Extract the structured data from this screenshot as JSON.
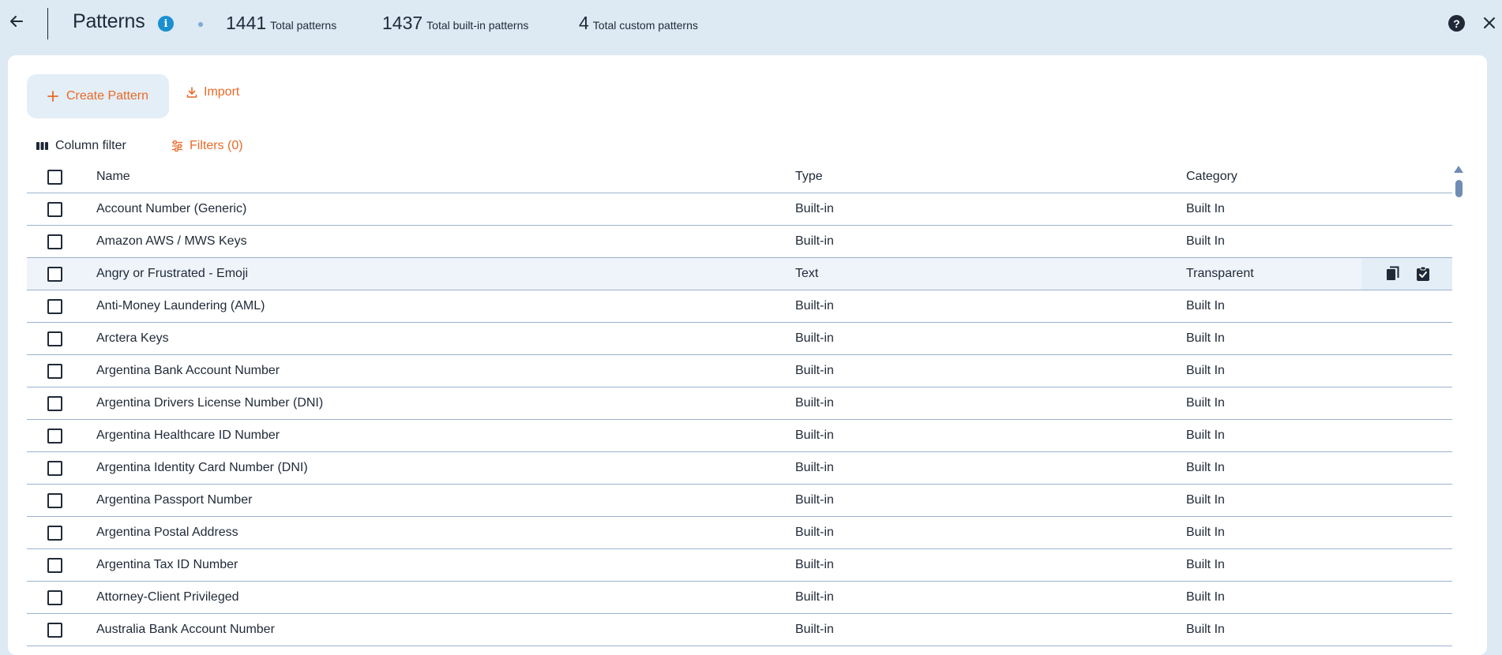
{
  "header": {
    "title": "Patterns",
    "stats": [
      {
        "value": "1441",
        "label": "Total patterns"
      },
      {
        "value": "1437",
        "label": "Total built-in patterns"
      },
      {
        "value": "4",
        "label": "Total custom patterns"
      }
    ]
  },
  "toolbar": {
    "create_label": "Create Pattern",
    "import_label": "Import",
    "column_filter_label": "Column filter",
    "filters_label": "Filters (0)"
  },
  "table": {
    "columns": [
      "Name",
      "Type",
      "Category"
    ],
    "rows": [
      {
        "name": "Account Number (Generic)",
        "type": "Built-in",
        "category": "Built In"
      },
      {
        "name": "Amazon AWS / MWS Keys",
        "type": "Built-in",
        "category": "Built In"
      },
      {
        "name": "Angry or Frustrated - Emoji",
        "type": "Text",
        "category": "Transparent"
      },
      {
        "name": "Anti-Money Laundering (AML)",
        "type": "Built-in",
        "category": "Built In"
      },
      {
        "name": "Arctera Keys",
        "type": "Built-in",
        "category": "Built In"
      },
      {
        "name": "Argentina Bank Account Number",
        "type": "Built-in",
        "category": "Built In"
      },
      {
        "name": "Argentina Drivers License Number (DNI)",
        "type": "Built-in",
        "category": "Built In"
      },
      {
        "name": "Argentina Healthcare ID Number",
        "type": "Built-in",
        "category": "Built In"
      },
      {
        "name": "Argentina Identity Card Number (DNI)",
        "type": "Built-in",
        "category": "Built In"
      },
      {
        "name": "Argentina Passport Number",
        "type": "Built-in",
        "category": "Built In"
      },
      {
        "name": "Argentina Postal Address",
        "type": "Built-in",
        "category": "Built In"
      },
      {
        "name": "Argentina Tax ID Number",
        "type": "Built-in",
        "category": "Built In"
      },
      {
        "name": "Attorney-Client Privileged",
        "type": "Built-in",
        "category": "Built In"
      },
      {
        "name": "Australia Bank Account Number",
        "type": "Built-in",
        "category": "Built In"
      }
    ]
  },
  "colors": {
    "accent": "#e86a28",
    "info": "#1a8fd1",
    "background": "#dde9f3",
    "row_divider": "#9bb2cf"
  },
  "icons": {
    "back": "arrow-left-icon",
    "info": "info-icon",
    "help": "help-icon",
    "close": "close-icon",
    "create": "plus-icon",
    "import": "download-icon",
    "column_filter": "columns-icon",
    "filters": "sliders-icon",
    "row_copy": "copy-icon",
    "row_check": "checklist-icon"
  }
}
